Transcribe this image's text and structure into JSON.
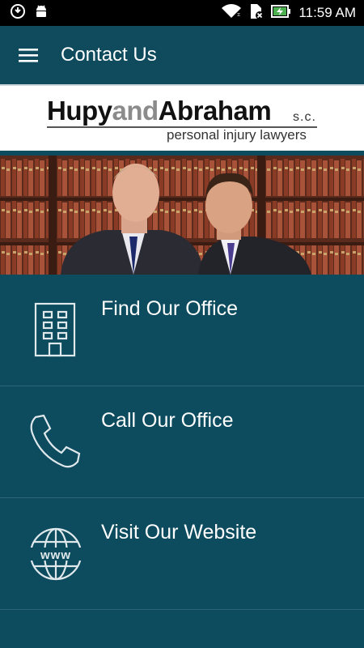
{
  "status_bar": {
    "time": "11:59 AM",
    "icons": [
      "sync-icon",
      "android-icon",
      "wifi-icon",
      "sim-blocked-icon",
      "battery-charging-icon"
    ]
  },
  "app_bar": {
    "title": "Contact Us",
    "menu_icon": "hamburger-menu-icon"
  },
  "logo": {
    "word1": "Hupy",
    "word2": "and",
    "word3": "Abraham",
    "suffix": "s.c.",
    "tagline": "personal injury lawyers"
  },
  "menu": [
    {
      "label": "Find Our Office",
      "icon": "building-icon"
    },
    {
      "label": "Call Our Office",
      "icon": "phone-icon"
    },
    {
      "label": "Visit Our Website",
      "icon": "globe-www-icon"
    }
  ],
  "colors": {
    "background": "#0d4b5e",
    "status_bar": "#000000",
    "divider": "#2b6577",
    "icon_stroke": "#dfe8eb"
  }
}
